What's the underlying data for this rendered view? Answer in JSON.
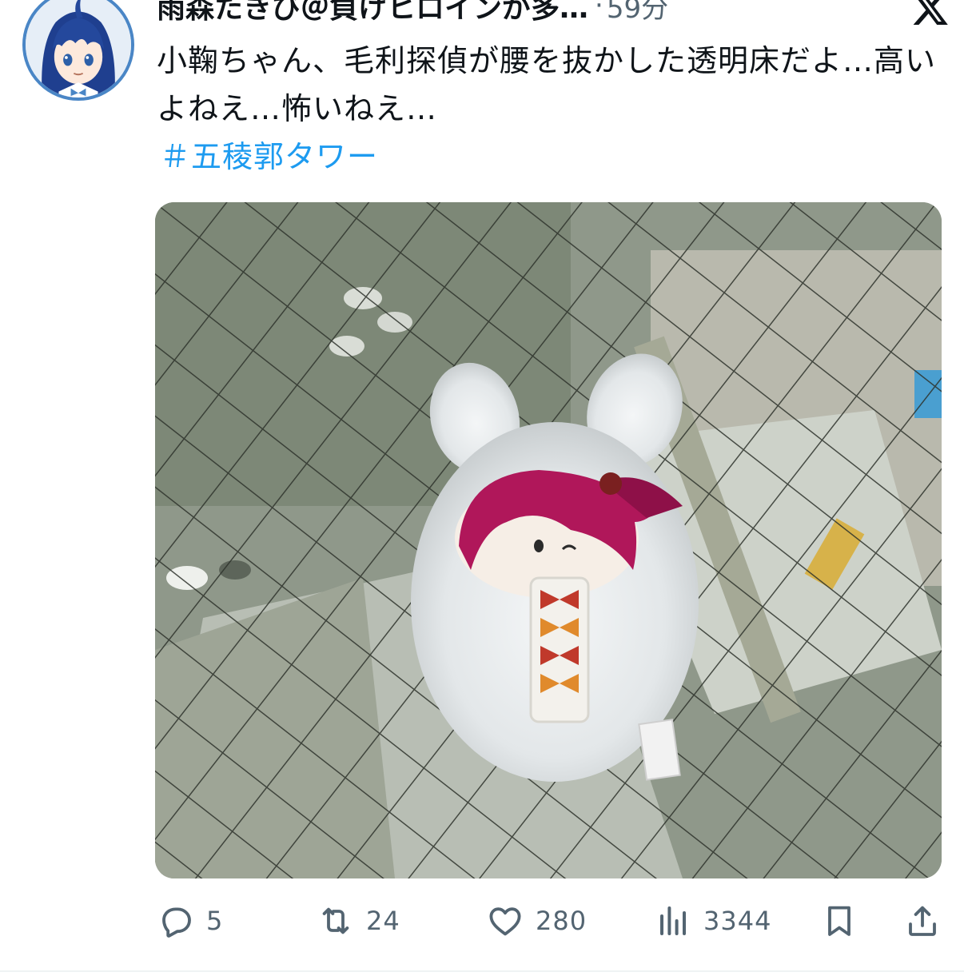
{
  "tweet": {
    "display_name": "雨森たきび＠負けヒロインが多…",
    "separator": "·",
    "timestamp": "59分",
    "text": "小鞠ちゃん、毛利探偵が腰を抜かした透明床だよ…高いよねえ…怖いねえ…",
    "hashtag": "＃五稜郭タワー"
  },
  "actions": {
    "reply_count": "5",
    "retweet_count": "24",
    "like_count": "280",
    "views_count": "3344"
  },
  "icons": {
    "brand": "x-logo-icon",
    "reply": "reply-icon",
    "retweet": "retweet-icon",
    "like": "heart-icon",
    "views": "views-icon",
    "bookmark": "bookmark-icon",
    "share": "share-icon"
  },
  "colors": {
    "text": "#0f1419",
    "secondary": "#536471",
    "link": "#1d9bf0",
    "avatar_ring": "#4a86c6",
    "plush_hair": "#b0175a"
  }
}
